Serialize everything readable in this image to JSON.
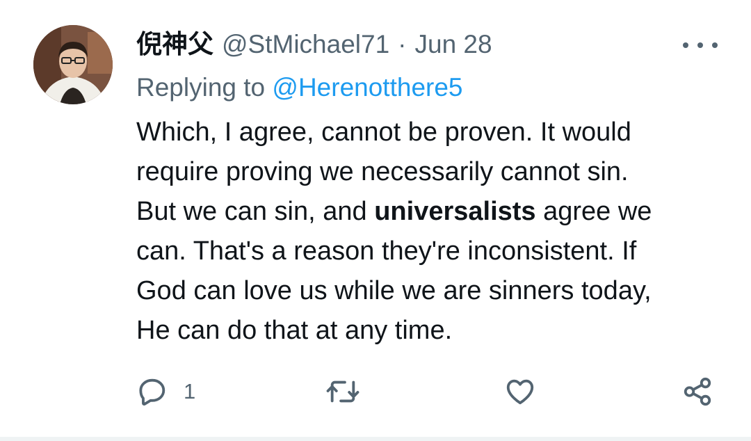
{
  "tweet": {
    "display_name": "倪神父",
    "handle": "@StMichael71",
    "separator": "·",
    "date": "Jun 28",
    "replying_prefix": "Replying to ",
    "replying_to": "@Herenotthere5",
    "text": {
      "line1": "Which, I agree, cannot be proven. It would",
      "line2": "require proving we necessarily cannot sin.",
      "line3_before": "But we can sin, and ",
      "line3_bold": "universalists",
      "line3_after": " agree we",
      "line4": "can. That's a reason they're inconsistent. If",
      "line5": "God can love us while we are sinners today,",
      "line6": "He can do that at any time."
    },
    "actions": {
      "reply_count": "1",
      "icons": [
        "reply-icon",
        "retweet-icon",
        "like-icon",
        "share-icon"
      ]
    }
  },
  "colors": {
    "text_primary": "#0f1419",
    "text_secondary": "#536471",
    "link": "#1d9bf0",
    "background": "#ffffff"
  }
}
